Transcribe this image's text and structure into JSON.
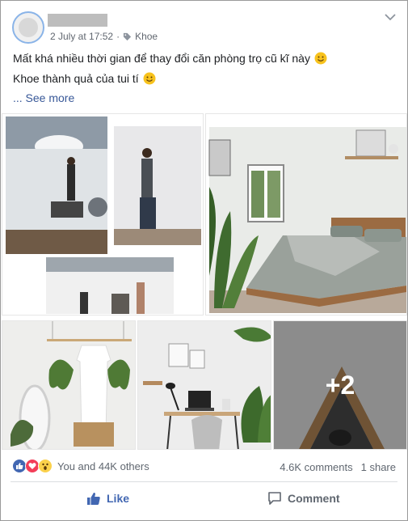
{
  "post": {
    "date": "2 July at 17:52",
    "separator": "·",
    "tag": "Khoe",
    "lines": [
      "Mất khá nhiều thời gian để thay đổi căn phòng trọ cũ kĩ này",
      "Khoe thành quả của tui tí"
    ],
    "see_more": "... See more"
  },
  "photos": {
    "more_count": "+2"
  },
  "reactions": {
    "types": [
      "like-icon",
      "love-icon",
      "wow-icon"
    ],
    "summary": "You and 44K others",
    "comments": "4.6K comments",
    "shares": "1 share"
  },
  "actions": {
    "like_label": "Like",
    "comment_label": "Comment"
  },
  "colors": {
    "link": "#385898",
    "like_blue": "#4267b2",
    "love_red": "#f33e58",
    "wow_yellow": "#fbd14b"
  }
}
